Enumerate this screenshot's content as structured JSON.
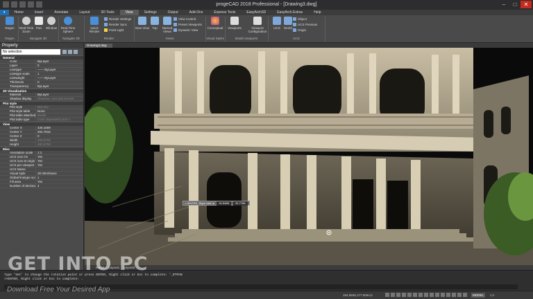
{
  "window": {
    "title": "progeCAD 2018 Professional - [Drawing3.dwg]",
    "minimize": "–",
    "maximize": "□",
    "close": "✕"
  },
  "menu_tabs": [
    "Home",
    "Insert",
    "Annotate",
    "Layout",
    "3D Tools",
    "View",
    "Settings",
    "Output",
    "Add-Ons",
    "Express Tools",
    "EasyArch3D",
    "EasyArch Extras",
    "Help"
  ],
  "active_tab": "View",
  "ribbon": {
    "tools": {
      "regen": "Regen",
      "realtime_zoom": "Real-Time Zoom",
      "pan": "Pan",
      "window": "Window",
      "realtime_sphere": "Real-Time Sphere",
      "quick_render": "Quick Render",
      "new_view": "New View",
      "top": "Top",
      "named_views": "Named Views",
      "conceptual": "Conceptual",
      "viewports": "Viewports",
      "viewport_config": "Viewport Configuration",
      "ucs": "UCS",
      "world": "World"
    },
    "small_tools": {
      "render_settings": "Render Settings",
      "render_sync": "Render Sync",
      "point_light": "Point Light",
      "view_control": "View Control",
      "preset_viewports": "Preset Viewports",
      "dynamic_view": "Dynamic View",
      "object": "Object",
      "ucs_previous": "UCS Previous",
      "origin": "Origin"
    },
    "groups": {
      "regen": "Regen",
      "navigate_2d": "Navigate 2D",
      "navigate_3d": "Navigate 3D",
      "render": "Render",
      "views": "Views",
      "visual_styles": "Visual Styles",
      "model_viewports": "Model viewports",
      "ucs": "UCS"
    }
  },
  "properties": {
    "title": "Property",
    "selection": "No selection",
    "sections": [
      {
        "name": "General",
        "rows": [
          {
            "k": "Color",
            "v": "ByLayer"
          },
          {
            "k": "Layer",
            "v": "0"
          },
          {
            "k": "Linetype",
            "v": "—— ByLayer"
          },
          {
            "k": "Linetype scale",
            "v": "1"
          },
          {
            "k": "Lineweight",
            "v": "—— ByLayer"
          },
          {
            "k": "Thickness",
            "v": "0"
          },
          {
            "k": "Transparency",
            "v": "ByLayer"
          }
        ]
      },
      {
        "name": "3D Visualization",
        "rows": [
          {
            "k": "Material",
            "v": "ByLayer"
          },
          {
            "k": "Shadow display",
            "v": "Shadows cast and receive",
            "dim": true
          }
        ]
      },
      {
        "name": "Plot style",
        "rows": [
          {
            "k": "Plot style",
            "v": "ByColor",
            "dim": true
          },
          {
            "k": "Plot style table",
            "v": "None"
          },
          {
            "k": "Plot table attached to",
            "v": "Model",
            "dim": true
          },
          {
            "k": "Plot table type",
            "v": "Color dependent print s",
            "dim": true
          }
        ]
      },
      {
        "name": "View",
        "rows": [
          {
            "k": "Center X",
            "v": "426.1659"
          },
          {
            "k": "Center Y",
            "v": "204.7816"
          },
          {
            "k": "Center Z",
            "v": "0"
          },
          {
            "k": "Width",
            "v": "483.5709",
            "dim": true
          },
          {
            "k": "Height",
            "v": "483.5709",
            "dim": true
          }
        ]
      },
      {
        "name": "Misc",
        "rows": [
          {
            "k": "Annotation scale",
            "v": "1:1"
          },
          {
            "k": "UCS icon On",
            "v": "Yes"
          },
          {
            "k": "UCS icon at origin",
            "v": "Yes"
          },
          {
            "k": "UCS per viewport",
            "v": "Yes"
          },
          {
            "k": "UCS Name",
            "v": ""
          },
          {
            "k": "Visual style",
            "v": "2D Wireframe"
          },
          {
            "k": "Global linetype scale",
            "v": "1"
          },
          {
            "k": "Fill area",
            "v": "Yes"
          },
          {
            "k": "Number of decimal places",
            "v": "4"
          }
        ]
      }
    ]
  },
  "viewport": {
    "tab": "Drawing3.dwg",
    "tooltip_prompt": ">>ENTER, Right click or",
    "tooltip_x": "41.5485",
    "tooltip_y": "31.7786"
  },
  "layout_tabs": [
    "Model",
    "Layout1",
    "Layout2"
  ],
  "command_line": {
    "line1": "Type 'Set' to change the rotation point or press ENTER, Right click or Esc to complete: '_RTPAN",
    "line2": ">>ENTER, Right click or Esc to complete: ."
  },
  "status_bar": {
    "coords": "154.5845,177.5064,0",
    "model": "MODEL",
    "scale": "1:1"
  },
  "watermark": {
    "main": "GET INTO PC",
    "sub": "Download Free Your Desired App"
  },
  "colors": {
    "accent": "#1e6eb3",
    "close": "#c42b1c"
  }
}
